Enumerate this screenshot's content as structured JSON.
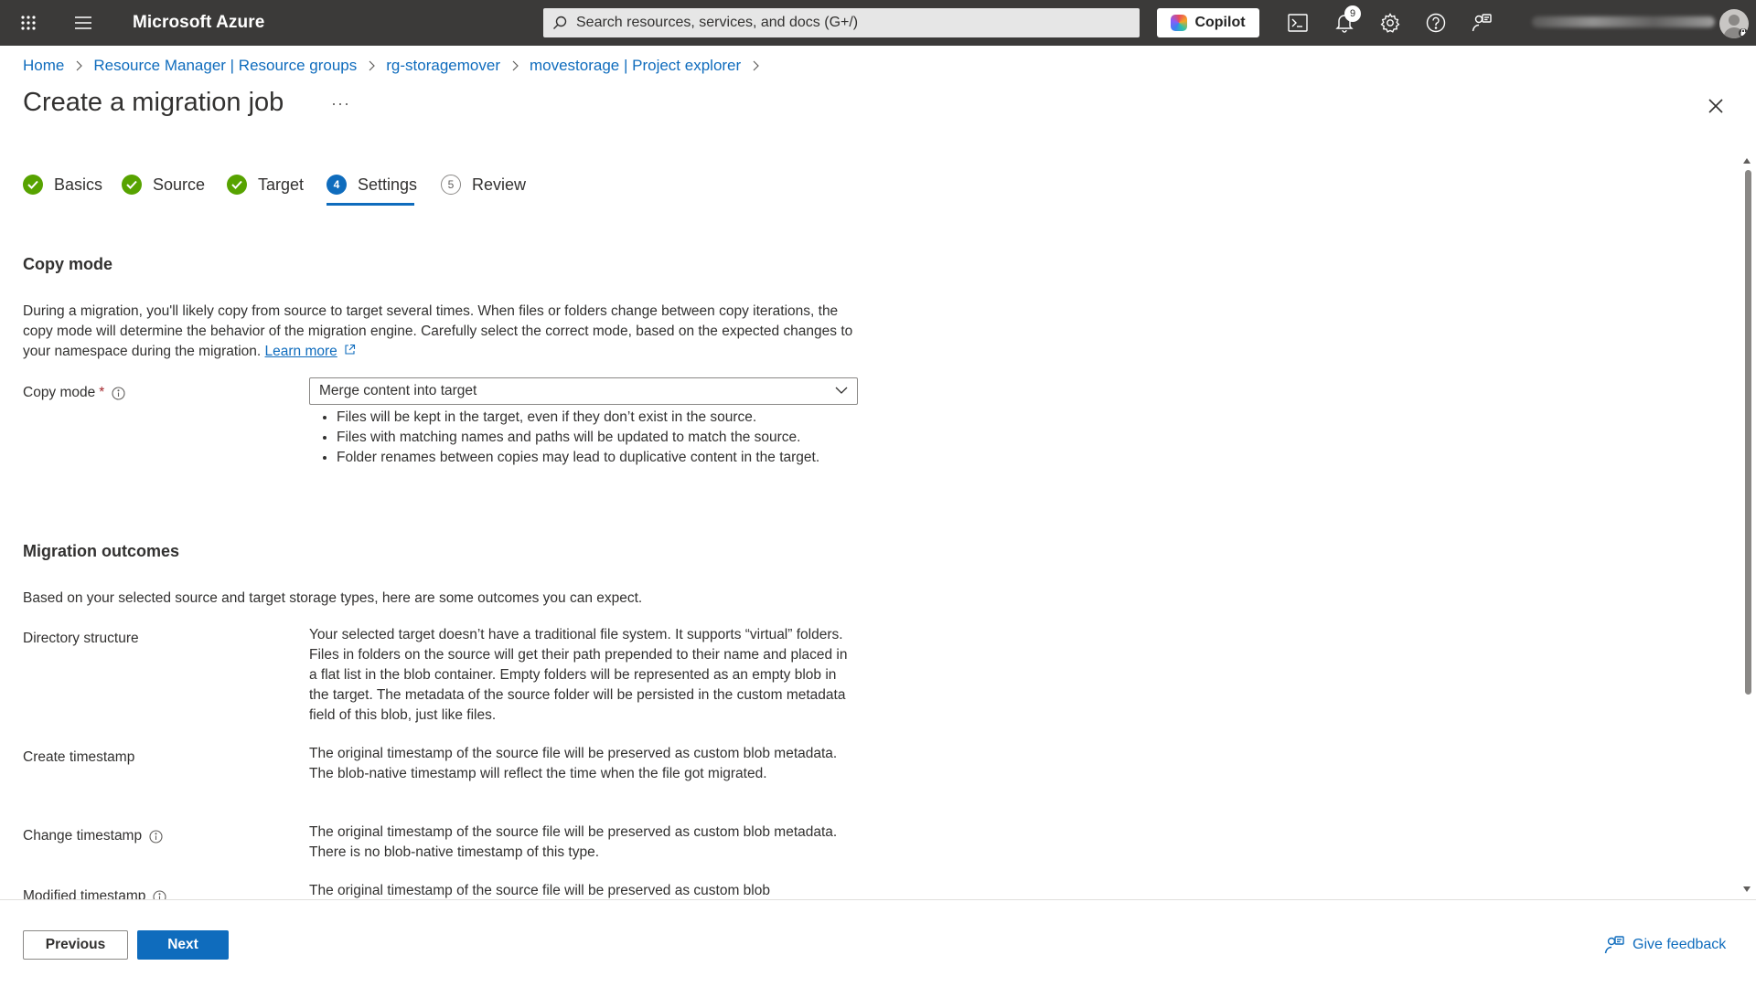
{
  "topbar": {
    "brand": "Microsoft Azure",
    "search_placeholder": "Search resources, services, and docs (G+/)",
    "copilot_label": "Copilot",
    "notification_count": "9"
  },
  "breadcrumb": [
    "Home",
    "Resource Manager | Resource groups",
    "rg-storagemover",
    "movestorage | Project explorer"
  ],
  "page": {
    "title": "Create a migration job",
    "more": "···"
  },
  "tabs": [
    {
      "label": "Basics",
      "state": "done"
    },
    {
      "label": "Source",
      "state": "done"
    },
    {
      "label": "Target",
      "state": "done"
    },
    {
      "label": "Settings",
      "state": "active",
      "number": "4"
    },
    {
      "label": "Review",
      "state": "todo",
      "number": "5"
    }
  ],
  "copy_mode": {
    "section_title": "Copy mode",
    "description": "During a migration, you'll likely copy from source to target several times. When files or folders change between copy iterations, the copy mode will determine the behavior of the migration engine. Carefully select the correct mode, based on the expected changes to your namespace during the migration.",
    "learn_more": "Learn more",
    "field_label": "Copy mode",
    "required_mark": "*",
    "selected": "Merge content into target",
    "bullets": [
      "Files will be kept in the target, even if they don’t exist in the source.",
      "Files with matching names and paths will be updated to match the source.",
      "Folder renames between copies may lead to duplicative content in the target."
    ]
  },
  "outcomes": {
    "section_title": "Migration outcomes",
    "intro": "Based on your selected source and target storage types, here are some outcomes you can expect.",
    "rows": [
      {
        "label": "Directory structure",
        "text": "Your selected target doesn’t have a traditional file system. It supports “virtual” folders. Files in folders on the source will get their path prepended to their name and placed in a flat list in the blob container. Empty folders will be represented as an empty blob in the target. The metadata of the source folder will be persisted in the custom metadata field of this blob, just like files."
      },
      {
        "label": "Create timestamp",
        "text": "The original timestamp of the source file will be preserved as custom blob metadata. The blob-native timestamp will reflect the time when the file got migrated."
      },
      {
        "label": "Change timestamp",
        "text": "The original timestamp of the source file will be preserved as custom blob metadata. There is no blob-native timestamp of this type."
      },
      {
        "label": "Modified timestamp",
        "text": "The original timestamp of the source file will be preserved as custom blob"
      }
    ]
  },
  "footer": {
    "previous": "Previous",
    "next": "Next",
    "feedback": "Give feedback"
  }
}
